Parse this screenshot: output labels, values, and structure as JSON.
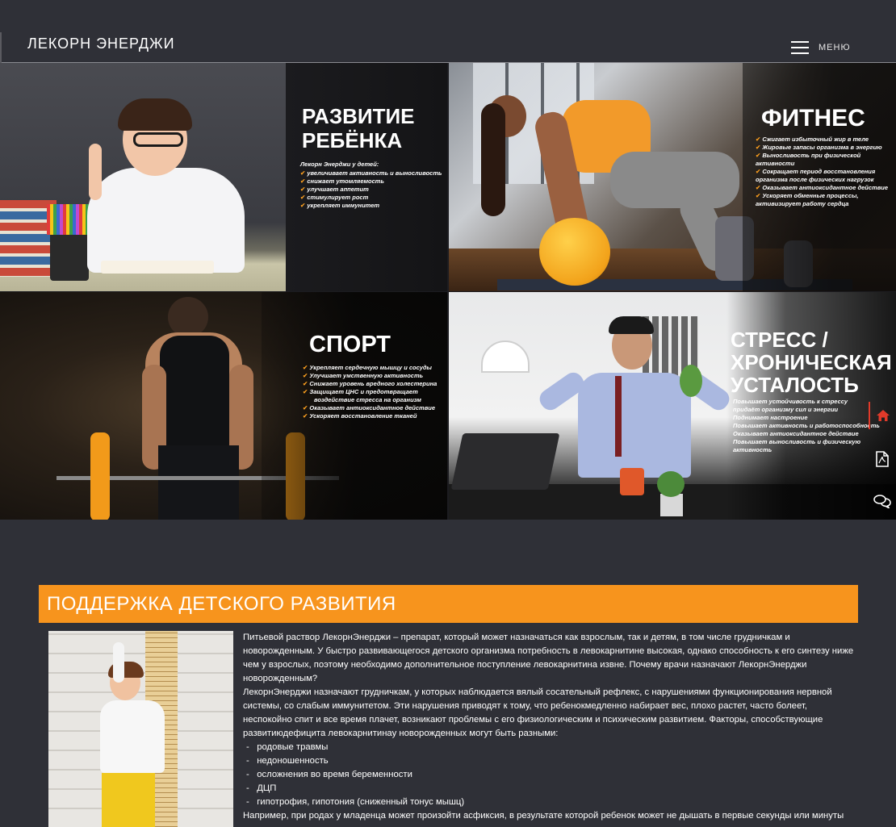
{
  "header": {
    "brand": "ЛЕКОРН ЭНЕРДЖИ",
    "menu_label": "МЕНЮ"
  },
  "tiles": [
    {
      "title_line1": "РАЗВИТИЕ",
      "title_line2": "РЕБЁНКА",
      "intro": "Лекорн Энерджи у детей:",
      "items": [
        "увеличивает активность и выносливость",
        "снижает утомляемость",
        "улучшает аппетит",
        "стимулирует рост",
        "укрепляет иммунитет"
      ]
    },
    {
      "title_line1": "ФИТНЕС",
      "items": [
        "Сжигает избыточный жир в теле",
        "Жировые запасы организма в энергию",
        "Выносливость при физической активности",
        "Сокращает период восстановления",
        "организма после физических нагрузок",
        "Оказывает антиоксидантное действие",
        "Ускоряет обменные процессы,",
        "активизирует работу сердца"
      ]
    },
    {
      "title_line1": "СПОРТ",
      "items": [
        "Укрепляет сердечную мышцу и сосуды",
        "Улучшает умственную активность",
        "Снижает уровень вредного холестерина",
        "Защищает ЦНС и предотвращает",
        "воздействие стресса на организм",
        "Оказывает антиоксидантное действие",
        "Ускоряет восстановление тканей"
      ]
    },
    {
      "title_line1": "СТРЕСС /",
      "title_line2": "ХРОНИЧЕСКАЯ",
      "title_line3": "УСТАЛОСТЬ",
      "items": [
        "Повышает устойчивость к стрессу",
        "придаёт организму сил и энергии",
        "Поднимает настроение",
        "Повышает активность и работоспособность",
        "Оказывает антиоксидантное действие",
        "Повышает выносливость и физическую активность"
      ]
    }
  ],
  "section": {
    "title": "ПОДДЕРЖКА ДЕТСКОГО РАЗВИТИЯ",
    "paragraph1": "Питьевой раствор ЛекорнЭнерджи – препарат, который может назначаться как взрослым, так и детям, в том числе грудничкам и новорожденным. У быстро развивающегося детского организма потребность в левокарнитине высокая, однако способность к его синтезу ниже чем у взрослых, поэтому необходимо дополнительное поступление левокарнитина извне. Почему врачи назначают ЛекорнЭнерджи новорожденным?",
    "paragraph2": "ЛекорнЭнерджи назначают грудничкам, у которых наблюдается вялый сосательный рефлекс, с нарушениями функционирования нервной системы, со слабым иммунитетом. Эти нарушения приводят к тому, что ребенокмедленно набирает вес, плохо растет, часто болеет, неспокойно спит и все время плачет, возникают проблемы с его физиологическим и психическим развитием. Факторы, способствующие развитиюдефицита левокарнитинау новорожденных могут быть разными:",
    "list": [
      "родовые травмы",
      "недоношенность",
      "осложнения во время беременности",
      "ДЦП",
      "гипотрофия, гипотония (сниженный тонус мышц)"
    ],
    "paragraph3": "Например, при родах у младенца может произойти асфиксия, в результате которой ребенок может не дышать в первые секунды или минуты"
  },
  "side_icons": [
    "home-icon",
    "pdf-icon",
    "chat-icon"
  ],
  "colors": {
    "accent": "#f7941d",
    "background": "#2f3037",
    "home_icon": "#e03a2a"
  }
}
